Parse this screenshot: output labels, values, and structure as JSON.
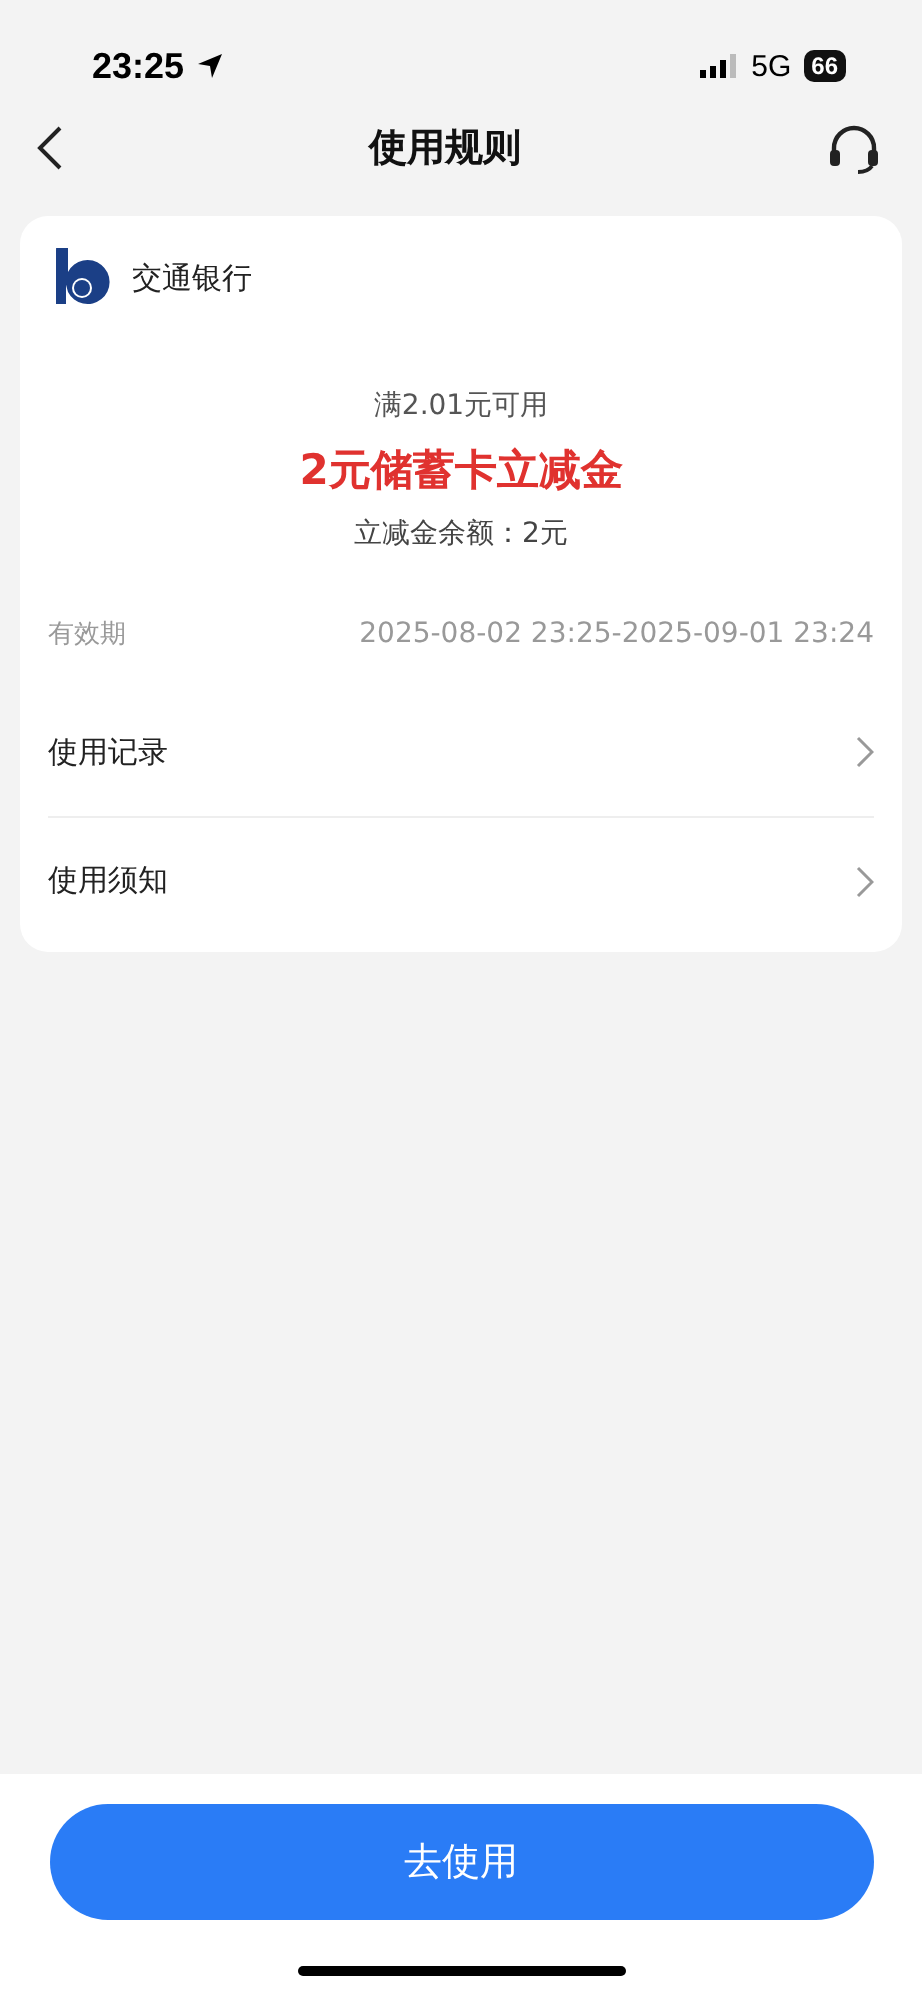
{
  "status_bar": {
    "time": "23:25",
    "network": "5G",
    "battery": "66"
  },
  "nav": {
    "title": "使用规则"
  },
  "card": {
    "bank_name": "交通银行",
    "condition": "满2.01元可用",
    "coupon_title": "2元储蓄卡立减金",
    "balance": "立减金余额：2元",
    "validity_label": "有效期",
    "validity_value": "2025-08-02 23:25-2025-09-01 23:24",
    "links": [
      {
        "label": "使用记录"
      },
      {
        "label": "使用须知"
      }
    ]
  },
  "action_button": {
    "label": "去使用"
  }
}
